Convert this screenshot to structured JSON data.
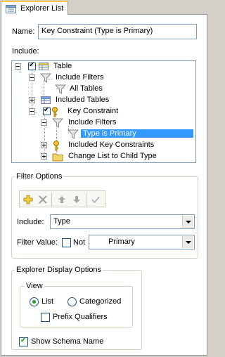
{
  "tab": {
    "label": "Explorer List",
    "icon": "explorer-list-icon"
  },
  "name": {
    "label": "Name:",
    "value": "Key Constraint (Type is Primary)"
  },
  "include_label": "Include:",
  "tree": {
    "rows": [
      {
        "label": "Table",
        "icon": "table-icon"
      },
      {
        "label": "Include Filters",
        "icon": "filter-icon"
      },
      {
        "label": "All Tables",
        "icon": "filter-icon"
      },
      {
        "label": "Included Tables",
        "icon": "table-icon"
      },
      {
        "label": "Key Constraint",
        "icon": "key-icon"
      },
      {
        "label": "Include Filters",
        "icon": "filter-icon"
      },
      {
        "label": "Type is Primary",
        "icon": "filter-icon"
      },
      {
        "label": "Included Key Constraints",
        "icon": "key-icon"
      },
      {
        "label": "Change List to Child Type",
        "icon": "folder-icon"
      }
    ],
    "selected": "Type is Primary"
  },
  "filter_options": {
    "title": "Filter Options",
    "toolbar": [
      "add-icon",
      "delete-icon",
      "move-up-icon",
      "move-down-icon",
      "apply-check-icon"
    ],
    "include_label": "Include:",
    "include_value": "Type",
    "filter_value_label": "Filter Value:",
    "not_label": "Not",
    "filter_value": "Primary"
  },
  "explorer_display": {
    "title": "Explorer Display Options",
    "view": {
      "title": "View",
      "list_label": "List",
      "categorized_label": "Categorized",
      "selected": "List",
      "prefix_label": "Prefix Qualifiers"
    },
    "show_schema_label": "Show Schema Name"
  },
  "colors": {
    "selection": "#3399ff",
    "accent_tab": "#ffc83c",
    "check": "#21a121"
  }
}
